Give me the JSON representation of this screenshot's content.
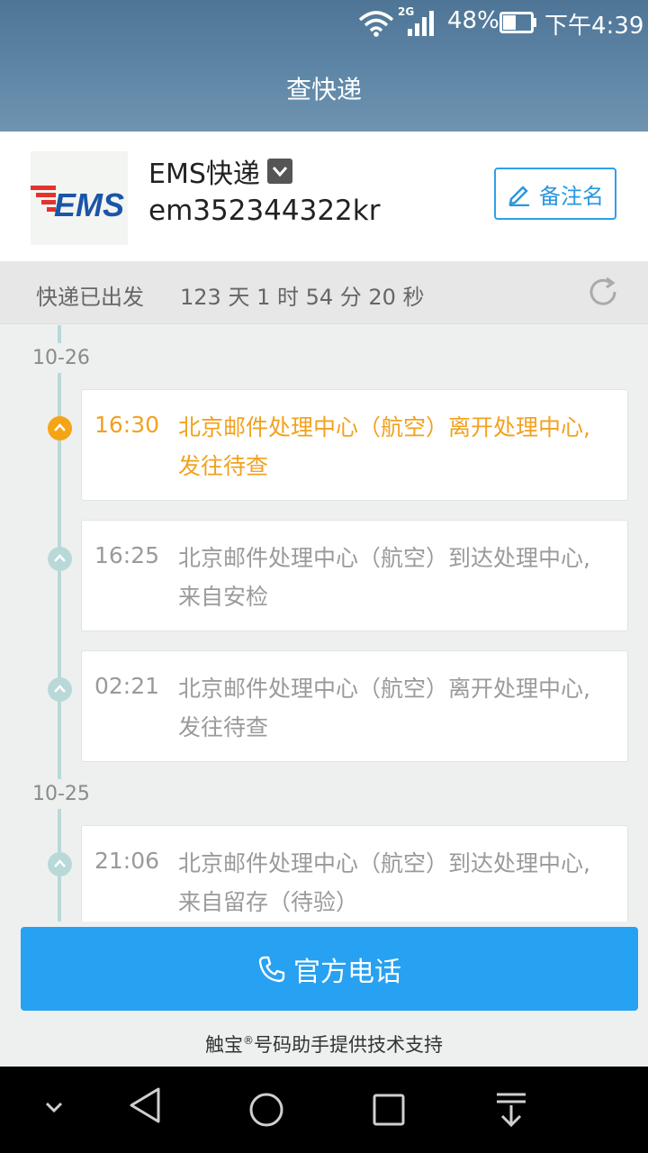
{
  "status_bar": {
    "network_type": "2G",
    "battery_percent": "48%",
    "battery_level": 0.48,
    "time": "下午4:39",
    "icons": [
      "wifi-icon",
      "signal-icon",
      "battery-icon"
    ]
  },
  "title": "查快递",
  "carrier": {
    "name": "EMS快递",
    "tracking_number": "em352344322kr",
    "logo_text": "EMS",
    "note_button": "备注名"
  },
  "shipped": {
    "label": "快递已出发",
    "duration": "123 天 1 时 54 分 20 秒"
  },
  "timeline": [
    {
      "date": "10-26"
    },
    {
      "time": "16:30",
      "desc": "北京邮件处理中心（航空）离开处理中心,发往待查",
      "active": true
    },
    {
      "time": "16:25",
      "desc": "北京邮件处理中心（航空）到达处理中心,来自安检",
      "active": false
    },
    {
      "time": "02:21",
      "desc": "北京邮件处理中心（航空）离开处理中心,发往待查",
      "active": false
    },
    {
      "date": "10-25"
    },
    {
      "time": "21:06",
      "desc": "北京邮件处理中心（航空）到达处理中心,来自留存（待验）",
      "active": false
    }
  ],
  "events": {
    "e1": {
      "time": "16:30",
      "desc": "北京邮件处理中心（航空）离开处理中心,发往待查"
    },
    "e2": {
      "time": "16:25",
      "desc": "北京邮件处理中心（航空）到达处理中心,来自安检"
    },
    "e3": {
      "time": "02:21",
      "desc": "北京邮件处理中心（航空）离开处理中心,发往待查"
    },
    "e4": {
      "time": "21:06",
      "desc": "北京邮件处理中心（航空）到达处理中心,来自留存（待验）"
    }
  },
  "dates": {
    "d1": "10-26",
    "d2": "10-25"
  },
  "call_button": "官方电话",
  "footer": {
    "brand": "触宝",
    "reg": "®",
    "rest": "号码助手提供技术支持"
  },
  "colors": {
    "accent_blue": "#27a1f1",
    "active_orange": "#f2a11f",
    "timeline_teal": "#b9d9d9",
    "ems_red": "#e5322d",
    "ems_blue": "#1a55a8"
  }
}
